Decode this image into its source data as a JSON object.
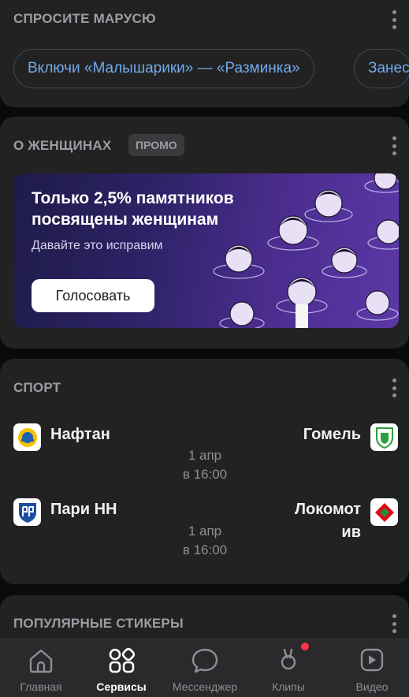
{
  "marusya": {
    "title": "СПРОСИТЕ МАРУСЮ",
    "chips": [
      "Включи «Малышарики» — «Разминка»",
      "Занес"
    ]
  },
  "women": {
    "title": "О ЖЕНЩИНАХ",
    "badge": "ПРОМО",
    "banner_title": "Только 2,5% памятников посвящены женщинам",
    "banner_subtitle": "Давайте это исправим",
    "vote_label": "Голосовать"
  },
  "sport": {
    "title": "СПОРТ",
    "matches": [
      {
        "home": "Нафтан",
        "away": "Гомель",
        "date": "1 апр",
        "time": "в 16:00"
      },
      {
        "home": "Пари НН",
        "away_line1": "Локомот",
        "away_line2": "ив",
        "date": "1 апр",
        "time": "в 16:00"
      }
    ]
  },
  "stickers": {
    "title": "ПОПУЛЯРНЫЕ СТИКЕРЫ"
  },
  "nav": {
    "items": [
      {
        "label": "Главная",
        "icon": "home-icon"
      },
      {
        "label": "Сервисы",
        "icon": "services-icon",
        "active": true
      },
      {
        "label": "Мессенджер",
        "icon": "messenger-icon"
      },
      {
        "label": "Клипы",
        "icon": "clips-icon",
        "badge_dot": true
      },
      {
        "label": "Видео",
        "icon": "video-icon"
      }
    ]
  },
  "colors": {
    "accent": "#71aaeb",
    "card": "#222222",
    "badge_red": "#ff3347"
  }
}
